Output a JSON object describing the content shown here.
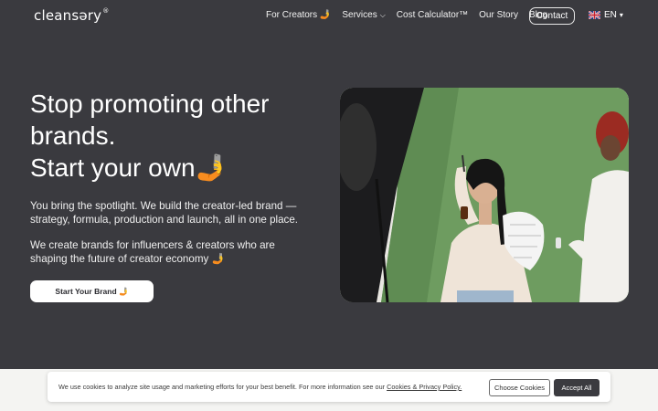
{
  "header": {
    "logo": "cleansəry",
    "logo_mark": "®",
    "nav": [
      {
        "label": "For Creators 🤳"
      },
      {
        "label": "Services",
        "chevron": "⌵"
      },
      {
        "label": "Cost Calculator™"
      },
      {
        "label": "Our Story"
      },
      {
        "label": "Blog"
      }
    ],
    "contact": "Contact",
    "language": "EN",
    "language_chevron": "▾"
  },
  "hero": {
    "title_line1": "Stop promoting other",
    "title_line2": "brands.",
    "title_line3": "Start your own🤳",
    "paragraph1": "You bring the spotlight. We build the creator-led brand — strategy, formula, production and launch, all in one place.",
    "paragraph2": "We create brands for influencers & creators who are shaping the future of creator economy 🤳",
    "cta": "Start Your Brand 🤳"
  },
  "cookie": {
    "text": "We use cookies to analyze site usage and marketing efforts for your best benefit. For more information see our ",
    "link": "Cookies & Privacy Policy.",
    "choose": "Choose Cookies",
    "accept": "Accept All"
  },
  "colors": {
    "background": "#3a3a3f",
    "cta_bg": "#ffffff",
    "accept_bg": "#3b3b40",
    "photo_green": "#6d9a5f"
  }
}
